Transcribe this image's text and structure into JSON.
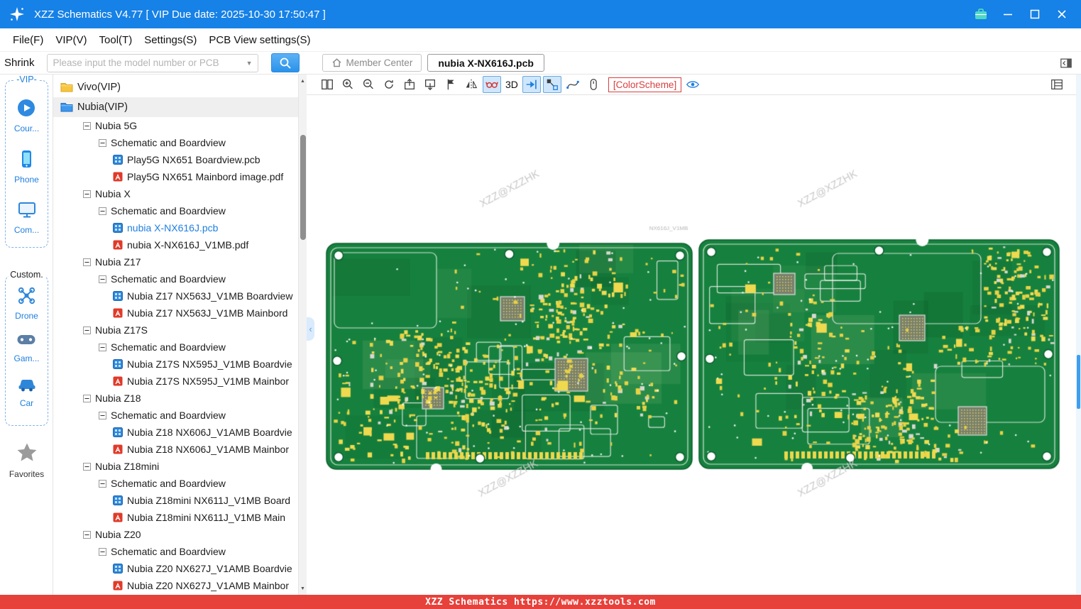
{
  "window": {
    "app_title": "XZZ Schematics V4.77 [ VIP Due date: 2025-10-30 17:50:47 ]"
  },
  "menu": {
    "items": [
      {
        "label": "File(F)"
      },
      {
        "label": "VIP(V)"
      },
      {
        "label": "Tool(T)"
      },
      {
        "label": "Settings(S)"
      },
      {
        "label": "PCB View settings(S)"
      }
    ]
  },
  "search": {
    "shrink_label": "Shrink",
    "placeholder": "Please input the model number or PCB",
    "member_center_label": "Member Center",
    "active_tab": "nubia X-NX616J.pcb"
  },
  "sidebar": {
    "vip_group_label": "-VIP-",
    "vip_items": [
      {
        "label": "Cour...",
        "icon": "course-play-icon"
      },
      {
        "label": "Phone",
        "icon": "phone-icon"
      },
      {
        "label": "Com...",
        "icon": "computer-icon"
      }
    ],
    "custom_group_label": "Custom.",
    "custom_items": [
      {
        "label": "Drone",
        "icon": "drone-icon"
      },
      {
        "label": "Gam...",
        "icon": "gamepad-icon"
      },
      {
        "label": "Car",
        "icon": "car-icon"
      }
    ],
    "favorites_label": "Favorites"
  },
  "tree": {
    "rows": [
      {
        "type": "folder",
        "label": "Vivo(VIP)",
        "color": "yellow",
        "level": 0
      },
      {
        "type": "folder",
        "label": "Nubia(VIP)",
        "color": "blue",
        "level": 0,
        "selected": true
      },
      {
        "type": "group",
        "label": "Nubia 5G",
        "level": 1
      },
      {
        "type": "group",
        "label": "Schematic and Boardview",
        "level": 2
      },
      {
        "type": "pcb",
        "label": "Play5G NX651 Boardview.pcb",
        "level": 3
      },
      {
        "type": "pdf",
        "label": "Play5G NX651 Mainbord image.pdf",
        "level": 3
      },
      {
        "type": "group",
        "label": "Nubia X",
        "level": 1
      },
      {
        "type": "group",
        "label": "Schematic and Boardview",
        "level": 2
      },
      {
        "type": "pcb",
        "label": "nubia X-NX616J.pcb",
        "level": 3,
        "active": true
      },
      {
        "type": "pdf",
        "label": "nubia X-NX616J_V1MB.pdf",
        "level": 3
      },
      {
        "type": "group",
        "label": "Nubia Z17",
        "level": 1
      },
      {
        "type": "group",
        "label": "Schematic and Boardview",
        "level": 2
      },
      {
        "type": "pcb",
        "label": "Nubia Z17 NX563J_V1MB Boardview",
        "level": 3
      },
      {
        "type": "pdf",
        "label": "Nubia Z17 NX563J_V1MB Mainbord",
        "level": 3
      },
      {
        "type": "group",
        "label": "Nubia Z17S",
        "level": 1
      },
      {
        "type": "group",
        "label": "Schematic and Boardview",
        "level": 2
      },
      {
        "type": "pcb",
        "label": "Nubia Z17S NX595J_V1MB Boardvie",
        "level": 3
      },
      {
        "type": "pdf",
        "label": "Nubia Z17S NX595J_V1MB Mainbor",
        "level": 3
      },
      {
        "type": "group",
        "label": "Nubia Z18",
        "level": 1
      },
      {
        "type": "group",
        "label": "Schematic and Boardview",
        "level": 2
      },
      {
        "type": "pcb",
        "label": "Nubia Z18 NX606J_V1AMB Boardvie",
        "level": 3
      },
      {
        "type": "pdf",
        "label": "Nubia Z18 NX606J_V1AMB Mainbor",
        "level": 3
      },
      {
        "type": "group",
        "label": "Nubia Z18mini",
        "level": 1
      },
      {
        "type": "group",
        "label": "Schematic and Boardview",
        "level": 2
      },
      {
        "type": "pcb",
        "label": "Nubia Z18mini NX611J_V1MB Board",
        "level": 3
      },
      {
        "type": "pdf",
        "label": "Nubia Z18mini NX611J_V1MB Main",
        "level": 3
      },
      {
        "type": "group",
        "label": "Nubia Z20",
        "level": 1
      },
      {
        "type": "group",
        "label": "Schematic and Boardview",
        "level": 2
      },
      {
        "type": "pcb",
        "label": "Nubia Z20 NX627J_V1AMB Boardvie",
        "level": 3
      },
      {
        "type": "pdf",
        "label": "Nubia Z20 NX627J_V1AMB Mainbor",
        "level": 3
      }
    ]
  },
  "toolbar": {
    "threeD_label": "3D",
    "colorscheme_label": "[ColorScheme]"
  },
  "canvas": {
    "watermark": "XZZ@XZZHK",
    "board_caption": "NX616J_V1MB",
    "colors": {
      "board_green": "#16813e",
      "board_edge": "#0b5e2d",
      "pad_yellow": "#e8d245",
      "pad_yellow2": "#f0dc52",
      "silk_white": "#f2f3ec",
      "watermark_gray": "#c9c9c9"
    }
  },
  "statusbar": {
    "text": "XZZ Schematics https://www.xzztools.com"
  }
}
